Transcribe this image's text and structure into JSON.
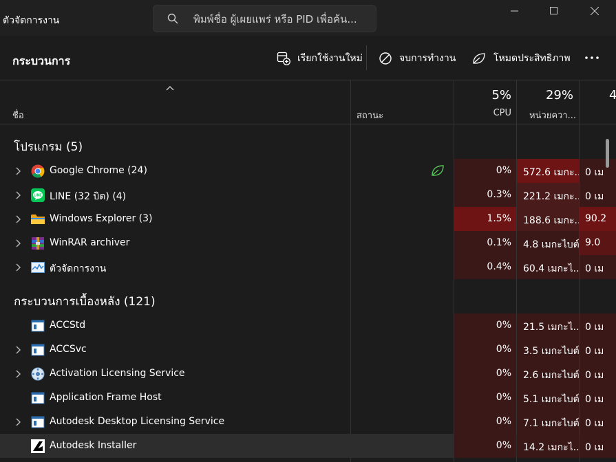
{
  "app": {
    "title": "ตัวจัดการงาน"
  },
  "search": {
    "placeholder": "พิมพ์ชื่อ ผู้เผยแพร่ หรือ PID เพื่อค้น..."
  },
  "toolbar": {
    "title": "กระบวนการ",
    "run_new_task": "เรียกใช้งานใหม่",
    "end_task": "จบการทำงาน",
    "efficiency_mode": "โหมดประสิทธิภาพ"
  },
  "columns": {
    "name": "ชื่อ",
    "status": "สถานะ",
    "cpu_pct": "5%",
    "cpu": "CPU",
    "memory_pct": "29%",
    "memory": "หน่วยควา...",
    "disk_pct": "4"
  },
  "sections": {
    "apps": "โปรแกรม (5)",
    "background": "กระบวนการเบื้องหลัง (121)"
  },
  "apps": [
    {
      "name": "Google Chrome (24)",
      "cpu": "0%",
      "memory": "572.6 เมกะ...",
      "disk": "0 เม"
    },
    {
      "name": "LINE (32 บิต) (4)",
      "cpu": "0.3%",
      "memory": "221.2 เมกะ...",
      "disk": "0 เม"
    },
    {
      "name": "Windows Explorer (3)",
      "cpu": "1.5%",
      "memory": "188.6 เมกะ...",
      "disk": "90.2"
    },
    {
      "name": "WinRAR archiver",
      "cpu": "0.1%",
      "memory": "4.8 เมกะไบต์",
      "disk": "9.0"
    },
    {
      "name": "ตัวจัดการงาน",
      "cpu": "0.4%",
      "memory": "60.4 เมกะไ...",
      "disk": "0 เม"
    }
  ],
  "background": [
    {
      "name": "ACCStd",
      "cpu": "0%",
      "memory": "21.5 เมกะไ...",
      "disk": "0 เม"
    },
    {
      "name": "ACCSvc",
      "cpu": "0%",
      "memory": "3.5 เมกะไบต์",
      "disk": "0 เม"
    },
    {
      "name": "Activation Licensing Service",
      "cpu": "0%",
      "memory": "2.6 เมกะไบต์",
      "disk": "0 เม"
    },
    {
      "name": "Application Frame Host",
      "cpu": "0%",
      "memory": "5.1 เมกะไบต์",
      "disk": "0 เม"
    },
    {
      "name": "Autodesk Desktop Licensing Service",
      "cpu": "0%",
      "memory": "7.1 เมกะไบต์",
      "disk": "0 เม"
    },
    {
      "name": "Autodesk Installer",
      "cpu": "0%",
      "memory": "14.2 เมกะไ...",
      "disk": "0 เม"
    }
  ]
}
